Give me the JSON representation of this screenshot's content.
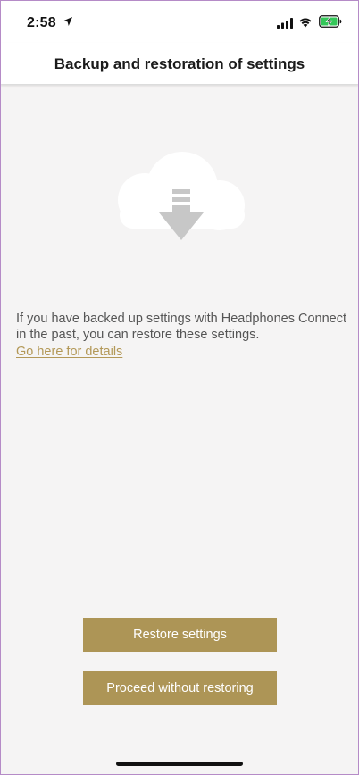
{
  "status_bar": {
    "time": "2:58",
    "icons": [
      "location-arrow-icon",
      "cellular-signal-icon",
      "wifi-icon",
      "battery-charging-icon"
    ]
  },
  "header": {
    "title": "Backup and restoration of settings"
  },
  "illustration": {
    "icon": "cloud-download-icon"
  },
  "main": {
    "description": "If you have backed up settings with Headphones Connect in the past, you can restore these settings.",
    "details_link": "Go here for details"
  },
  "buttons": {
    "restore_label": "Restore settings",
    "proceed_label": "Proceed without restoring"
  },
  "colors": {
    "accent": "#ad9556",
    "link": "#b39857",
    "background": "#f5f4f4",
    "illustration": "#c7c7c7"
  }
}
